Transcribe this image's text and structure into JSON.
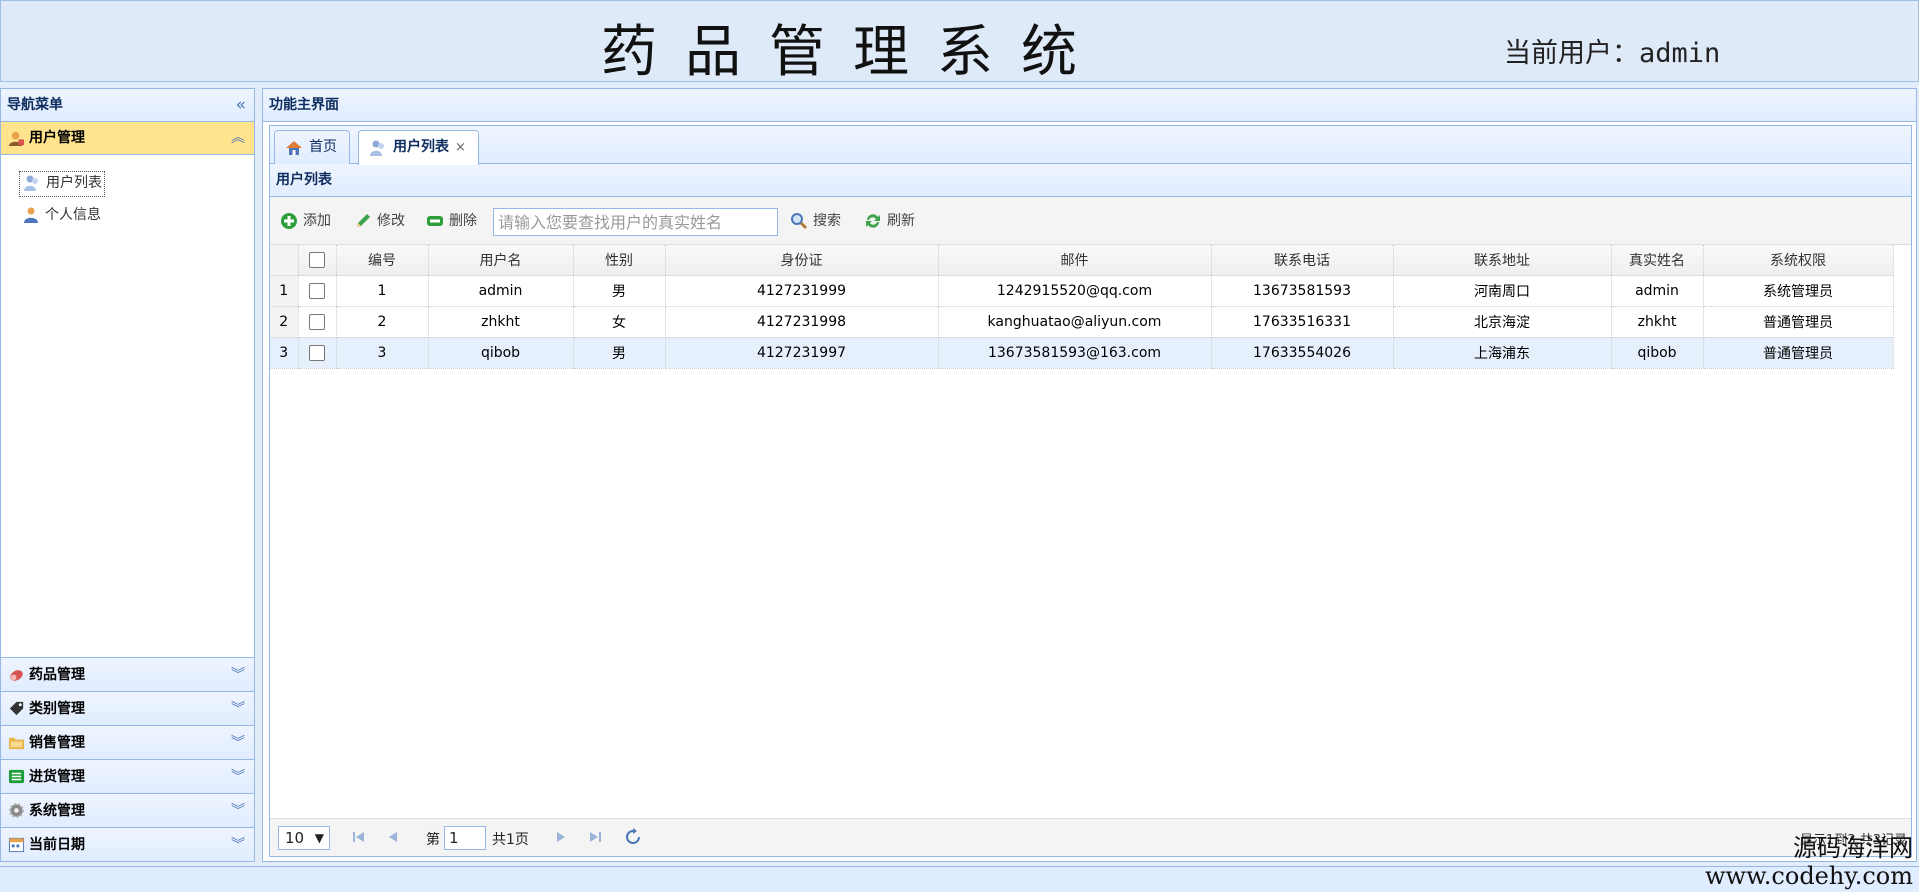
{
  "header": {
    "title": "药品管理系统",
    "current_user": "当前用户：admin"
  },
  "sidebar": {
    "title": "导航菜单",
    "collapse_icon": "«",
    "active_section": {
      "label": "用户管理",
      "items": [
        {
          "label": "用户列表",
          "icon": "users-icon"
        },
        {
          "label": "个人信息",
          "icon": "user-icon"
        }
      ]
    },
    "sections": [
      {
        "label": "药品管理",
        "icon": "pill-icon",
        "color": "#d9534f"
      },
      {
        "label": "类别管理",
        "icon": "tag-icon",
        "color": "#333333"
      },
      {
        "label": "销售管理",
        "icon": "folder-icon",
        "color": "#e8b64a"
      },
      {
        "label": "进货管理",
        "icon": "list-icon",
        "color": "#1e9e3a"
      },
      {
        "label": "系统管理",
        "icon": "gear-icon",
        "color": "#777777"
      },
      {
        "label": "当前日期",
        "icon": "calendar-icon",
        "color": "#4b76b8"
      }
    ]
  },
  "main": {
    "title": "功能主界面",
    "tabs": [
      {
        "label": "首页",
        "icon": "home-icon"
      },
      {
        "label": "用户列表",
        "icon": "users-icon",
        "close": "×"
      }
    ],
    "grid": {
      "title": "用户列表",
      "toolbar": {
        "add": "添加",
        "edit": "修改",
        "delete": "删除",
        "search_placeholder": "请输入您要查找用户的真实姓名",
        "search": "搜索",
        "refresh": "刷新"
      },
      "columns": [
        "编号",
        "用户名",
        "性别",
        "身份证",
        "邮件",
        "联系电话",
        "联系地址",
        "真实姓名",
        "系统权限"
      ],
      "rows": [
        {
          "rn": "1",
          "cells": [
            "1",
            "admin",
            "男",
            "4127231999",
            "1242915520@qq.com",
            "13673581593",
            "河南周口",
            "admin",
            "系统管理员"
          ]
        },
        {
          "rn": "2",
          "cells": [
            "2",
            "zhkht",
            "女",
            "4127231998",
            "kanghuatao@aliyun.com",
            "17633516331",
            "北京海淀",
            "zhkht",
            "普通管理员"
          ]
        },
        {
          "rn": "3",
          "cells": [
            "3",
            "qibob",
            "男",
            "4127231997",
            "13673581593@163.com",
            "17633554026",
            "上海浦东",
            "qibob",
            "普通管理员"
          ]
        }
      ],
      "pager": {
        "page_size": "10",
        "page_label_pre": "第",
        "page_value": "1",
        "page_label_post": "共1页",
        "info": "显示1到3,共3记录"
      }
    }
  },
  "watermark": {
    "line1": "源码海洋网",
    "line2": "www.codehy.com"
  },
  "colors": {
    "accent_border": "#95b8e7",
    "active_section": "#ffe48d",
    "header_bg": "#dfeaf8"
  }
}
